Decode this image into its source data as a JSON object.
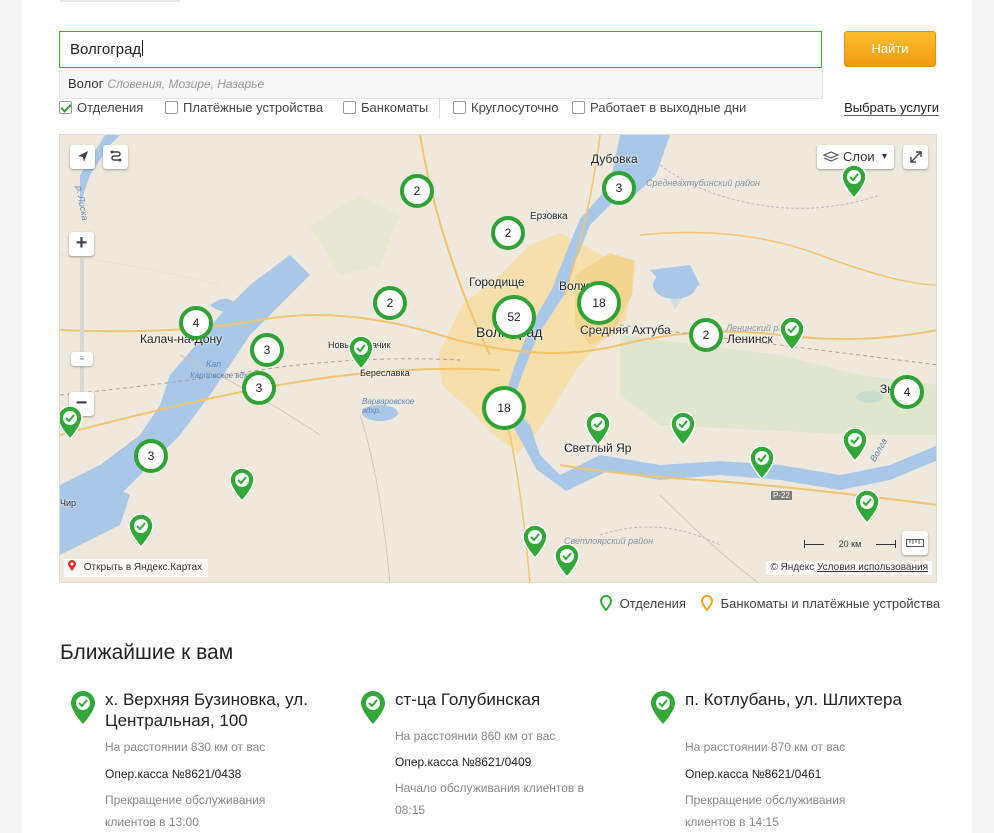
{
  "search": {
    "value": "Волгоград",
    "button_label": "Найти",
    "suggestion": {
      "main": "Волог",
      "sub": "Словения, Мозире, Назарье"
    }
  },
  "filters": {
    "items": [
      {
        "label": "Отделения",
        "checked": true
      },
      {
        "label": "Платёжные устройства",
        "checked": false
      },
      {
        "label": "Банкоматы",
        "checked": false
      },
      {
        "label": "Круглосуточно",
        "checked": false
      },
      {
        "label": "Работает в выходные дни",
        "checked": false
      }
    ],
    "choose_services": "Выбрать услуги"
  },
  "map": {
    "layers_label": "Слои",
    "open_yandex": "Открыть в Яндекс.Картах",
    "copyright": "© Яндекс",
    "terms": "Условия использования",
    "scale_label": "20 км",
    "colors": {
      "cluster": "#2ea234",
      "pin": "#32a839",
      "atm": "#f2a516",
      "water": "#a9c8e8",
      "land": "#efe9dd",
      "city": "#f5dfa5"
    },
    "clusters": [
      "2",
      "3",
      "2",
      "2",
      "52",
      "18",
      "2",
      "4",
      "3",
      "3",
      "18",
      "4",
      "3"
    ],
    "place_labels": [
      "Дубовка",
      "Ерзовка",
      "Городище",
      "Волгоград",
      "Волж",
      "Средняя Ахтуба",
      "Ленинск",
      "Калач-на-Дону",
      "Новый Рогачик",
      "Береславка",
      "Светлый Яр",
      "Зн",
      "Кап",
      "Чир"
    ],
    "area_labels": [
      "Среднеахтубинский район",
      "Ленинский район",
      "Светлоярский район"
    ],
    "water_labels": [
      "р. Лиска",
      "Карповское вдхр.",
      "Варваровское вдхр.",
      "Волга"
    ],
    "road_label": "Р-22"
  },
  "legend": {
    "offices": "Отделения",
    "atms": "Банкоматы и платёжные устройства"
  },
  "nearest": {
    "title": "Ближайшие к вам",
    "offices": [
      {
        "address": "х. Верхняя Бузиновка, ул. Центральная, 100",
        "distance": "На расстоянии 830 км от вас",
        "kassa": "Опер.касса №8621/0438",
        "status": "Прекращение обслуживания клиентов в 13:00"
      },
      {
        "address": "ст-ца Голубинская",
        "distance": "На расстоянии 860 км от вас",
        "kassa": "Опер.касса №8621/0409",
        "status": "Начало обслуживания клиентов в 08:15"
      },
      {
        "address": "п. Котлубань, ул. Шлихтера",
        "distance": "На расстоянии 870 км от вас",
        "kassa": "Опер.касса №8621/0461",
        "status": "Прекращение обслуживания клиентов в 14:15"
      }
    ]
  }
}
